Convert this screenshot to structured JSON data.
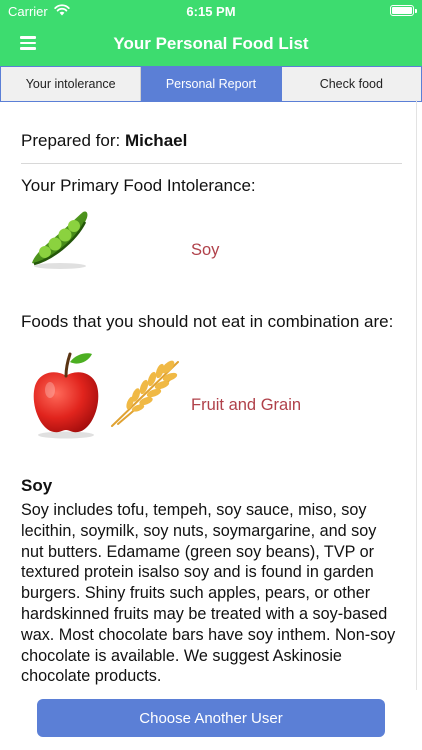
{
  "status_bar": {
    "carrier": "Carrier",
    "time": "6:15 PM",
    "wifi_icon": "wifi-icon",
    "battery_icon": "battery-icon"
  },
  "nav": {
    "title": "Your Personal Food List",
    "menu_icon": "hamburger-menu-icon"
  },
  "tabs": [
    {
      "label": "Your intolerance",
      "active": false
    },
    {
      "label": "Personal Report",
      "active": true
    },
    {
      "label": "Check food",
      "active": false
    }
  ],
  "report": {
    "prepared_label": "Prepared for:",
    "user_name": "Michael",
    "primary_heading": "Your Primary Food Intolerance:",
    "primary_intolerance": "Soy",
    "combination_heading": "Foods that you should not eat in combination are:",
    "combination_foods": "Fruit and Grain",
    "section_title": "Soy",
    "description": "Soy includes tofu, tempeh, soy sauce, miso, soy lecithin, soymilk, soy nuts, soymargarine, and soy nut butters. Edamame (green soy beans), TVP or textured protein isalso soy and is found in garden burgers. Shiny fruits such apples, pears, or other hardskinned fruits may be treated with a soy-based wax. Most chocolate bars have soy inthem. Non-soy chocolate is available. We suggest Askinosie chocolate products."
  },
  "actions": {
    "choose_user": "Choose Another User"
  },
  "colors": {
    "header": "#3ddc6f",
    "accent": "#5b7fd6",
    "highlight_text": "#b0414a"
  }
}
